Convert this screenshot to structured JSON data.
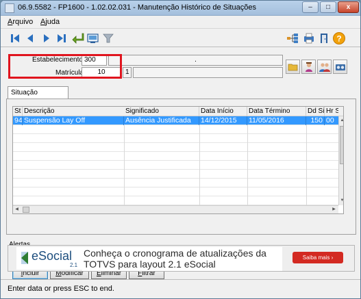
{
  "window": {
    "title": "06.9.5582 - FP1600 - 1.02.02.031 - Manutenção Histórico de Situações",
    "minimize": "–",
    "maximize": "□",
    "close": "x"
  },
  "menu": {
    "items": [
      "Arquivo",
      "Ajuda"
    ]
  },
  "toolbar": {
    "left_icons": [
      "first-icon",
      "previous-icon",
      "next-icon",
      "last-icon",
      "goto-icon",
      "search-icon",
      "filter-icon"
    ],
    "right_icons": [
      "tree-icon",
      "print-icon",
      "exit-icon",
      "help-icon"
    ]
  },
  "form": {
    "estabelecimento_label": "Estabelecimento:",
    "estabelecimento_value": "300",
    "estabelecimento_desc": ".",
    "matricula_label": "Matrícula:",
    "matricula_value": "10",
    "matricula_digit": "1",
    "matricula_name": ""
  },
  "tab": {
    "label": "Situação"
  },
  "grid": {
    "columns": [
      "St",
      "Descrição",
      "Significado",
      "Data Início",
      "Data Término",
      "Dd Sit",
      "Hr S"
    ],
    "rows": [
      [
        "94",
        "Suspensão Lay Off",
        "Ausência Justificada",
        "14/12/2015",
        "11/05/2016",
        "150",
        "00"
      ]
    ]
  },
  "actions": {
    "incluir": "Incluir",
    "modificar": "Modificar",
    "eliminar": "Eliminar",
    "filtrar": "Filtrar"
  },
  "alerts": {
    "label": "Alertas",
    "logo_text": "eSocial",
    "logo_version": "2.1",
    "message": "Conheça o cronograma de atualizações da TOTVS para layout 2.1 eSocial",
    "button": "Saiba mais ›"
  },
  "status": {
    "text": "Enter data or press ESC to end."
  },
  "colors": {
    "selection": "#3399ff",
    "highlight_box": "#e0141e",
    "saiba_button": "#d32a22"
  }
}
